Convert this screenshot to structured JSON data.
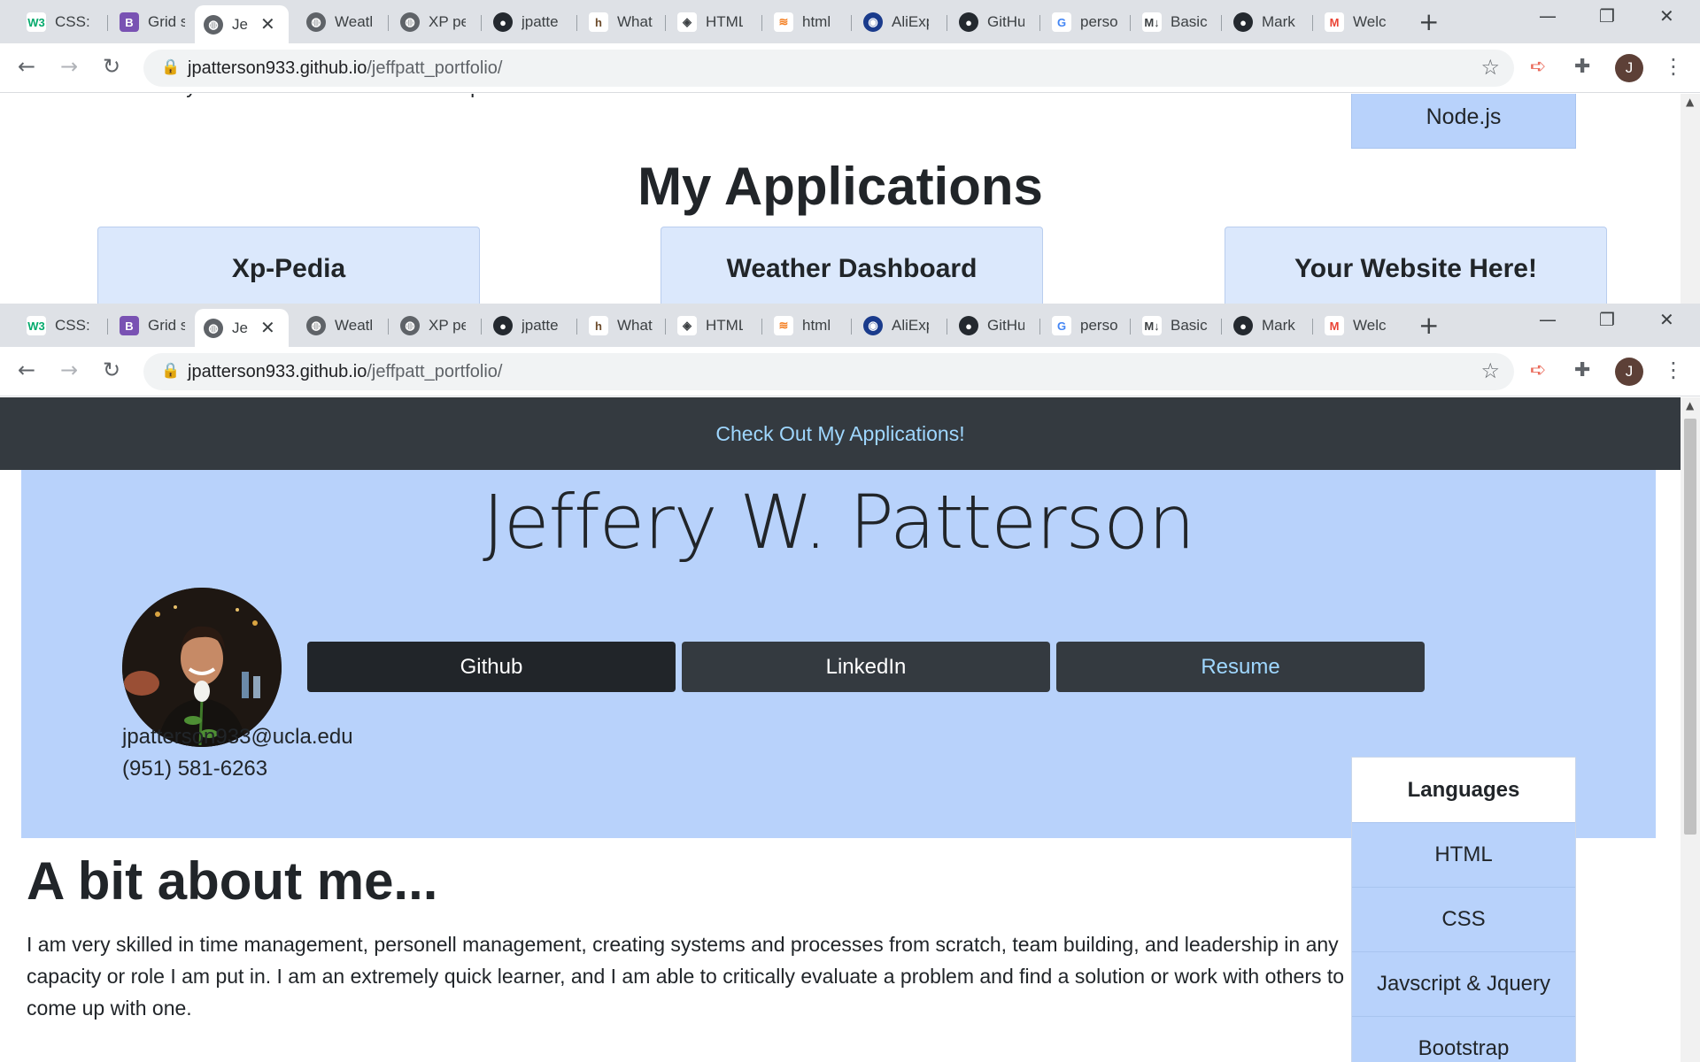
{
  "browser": {
    "tabs": [
      {
        "title": "CSS: c",
        "icon": "w3schools-icon",
        "color": "#04aa6d"
      },
      {
        "title": "Grid s",
        "icon": "bootstrap-icon",
        "color": "#7952b3"
      },
      {
        "title": "Je",
        "icon": "globe-icon",
        "active": true
      },
      {
        "title": "Weatl",
        "icon": "globe-icon"
      },
      {
        "title": "XP pe",
        "icon": "globe-icon"
      },
      {
        "title": "jpatte",
        "icon": "github-icon"
      },
      {
        "title": "What",
        "icon": "houzz-icon"
      },
      {
        "title": "HTML",
        "icon": "diamond-icon"
      },
      {
        "title": "html",
        "icon": "stackoverflow-icon",
        "color": "#f48024"
      },
      {
        "title": "AliExp",
        "icon": "aliexpress-icon"
      },
      {
        "title": "GitHu",
        "icon": "github-icon"
      },
      {
        "title": "perso",
        "icon": "google-icon"
      },
      {
        "title": "Basic",
        "icon": "markdown-icon"
      },
      {
        "title": "Mark",
        "icon": "github-icon"
      },
      {
        "title": "Welc",
        "icon": "gmail-icon",
        "color": "#ea4335"
      }
    ],
    "close_glyph": "✕",
    "new_tab": "+",
    "url_host": "jpatterson933.github.io",
    "url_path": "/jeffpatt_portfolio/",
    "profile_initial": "J"
  },
  "top_view": {
    "intro_tail": "would make a very well rounded front-end devleoper who would thrive in a team environment.",
    "skill_visible": "Node.js",
    "apps_heading": "My Applications",
    "apps": [
      "Xp-Pedia",
      "Weather Dashboard",
      "Your Website Here!"
    ]
  },
  "bottom_view": {
    "nav_link": "Check Out My Applications!",
    "name": "Jeffery W. Patterson",
    "buttons": [
      {
        "label": "Github",
        "bg": "#212529",
        "color": "#ffffff"
      },
      {
        "label": "LinkedIn",
        "bg": "#343a40",
        "color": "#ffffff"
      },
      {
        "label": "Resume",
        "bg": "#343a40",
        "color": "#9fd7ff"
      }
    ],
    "email": "jpatterson933@ucla.edu",
    "phone": "(951) 581-6263",
    "about_heading": "A bit about me...",
    "about_text": "I am very skilled in time management, personell management, creating systems and processes from scratch, team building, and leadership in any capacity or role I am put in. I am an extremely quick learner, and I am able to critically evaluate a problem and find a solution or work with others to come up with one.",
    "languages_header": "Languages",
    "languages": [
      "HTML",
      "CSS",
      "Javscript & Jquery",
      "Bootstrap"
    ]
  }
}
